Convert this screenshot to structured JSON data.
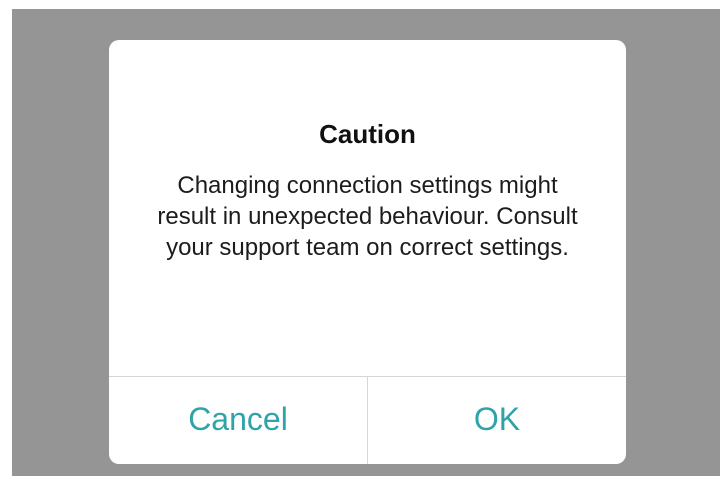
{
  "dialog": {
    "title": "Caution",
    "message": "Changing connection settings might result in unexpected behaviour. Consult your support team on correct settings.",
    "buttons": {
      "cancel": "Cancel",
      "ok": "OK"
    }
  },
  "colors": {
    "overlay": "#959595",
    "button_text": "#2ea4a8",
    "dialog_background": "#ffffff"
  }
}
